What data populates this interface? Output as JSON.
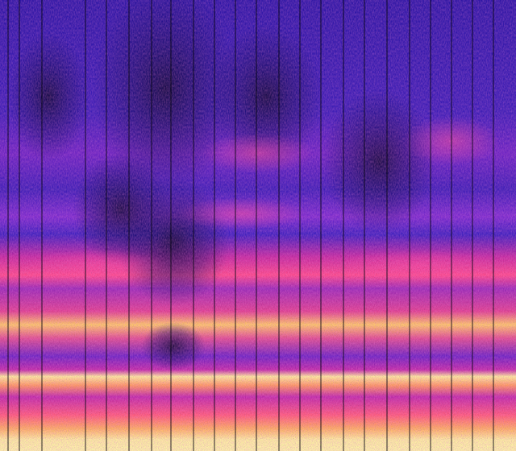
{
  "image": {
    "kind": "spectrogram",
    "colormap": [
      "#0b0630",
      "#1f0f8a",
      "#3b1fc0",
      "#7a2ad0",
      "#c02aa8",
      "#ff3a8a",
      "#ff7a55",
      "#ffd26a",
      "#fff6a0"
    ],
    "background_color": "#1e127e",
    "separator_color": "#050510",
    "bottom_band_color": "#f7f28f"
  }
}
